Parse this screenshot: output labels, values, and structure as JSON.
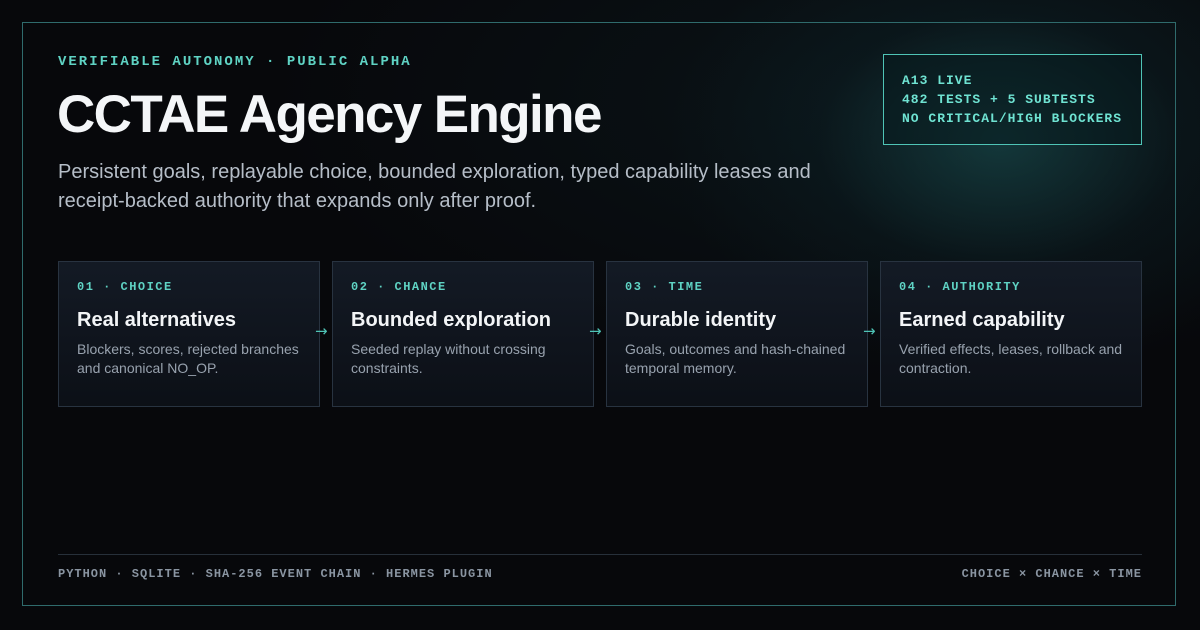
{
  "eyebrow": "VERIFIABLE AUTONOMY · PUBLIC ALPHA",
  "title": "CCTAE Agency Engine",
  "subtitle": "Persistent goals, replayable choice, bounded exploration, typed capability leases and receipt-backed authority that expands only after proof.",
  "status": {
    "lines": [
      "A13 LIVE",
      "482 TESTS + 5 SUBTESTS",
      "NO CRITICAL/HIGH BLOCKERS"
    ]
  },
  "cards": [
    {
      "label": "01 · CHOICE",
      "title": "Real alternatives",
      "description": "Blockers, scores, rejected branches and canonical NO_OP."
    },
    {
      "label": "02 · CHANCE",
      "title": "Bounded exploration",
      "description": "Seeded replay without crossing constraints."
    },
    {
      "label": "03 · TIME",
      "title": "Durable identity",
      "description": "Goals, outcomes and hash-chained temporal memory."
    },
    {
      "label": "04 · AUTHORITY",
      "title": "Earned capability",
      "description": "Verified effects, leases, rollback and contraction."
    }
  ],
  "arrow_glyph": "→",
  "footer": {
    "left": "PYTHON · SQLITE · SHA-256 EVENT CHAIN · HERMES PLUGIN",
    "right": "CHOICE × CHANCE × TIME"
  },
  "colors": {
    "accent": "#5fd3c4",
    "background": "#07080b",
    "frame": "#2f6b6c"
  }
}
